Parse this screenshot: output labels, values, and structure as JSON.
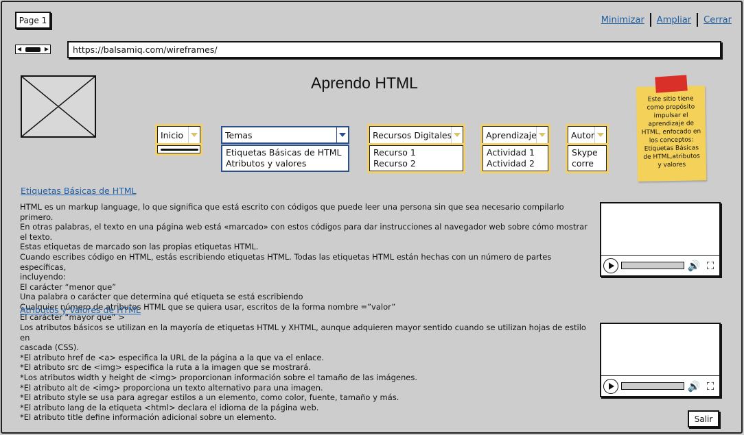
{
  "window": {
    "page_tab": "Page 1",
    "links": [
      "Minimizar",
      "Ampliar",
      "Cerrar"
    ]
  },
  "browser": {
    "url": "https://balsamiq.com/wireframes/"
  },
  "header": {
    "title": "Aprendo HTML"
  },
  "sticky_note": {
    "text": "Este sitio tiene como propósito impulsar el aprendizaje de HTML, enfocado en los conceptos: Etiquetas Básicas de HTML,atributos y valores"
  },
  "menus": {
    "inicio": {
      "label": "Inicio"
    },
    "temas": {
      "label": "Temas",
      "items": [
        "Etiquetas Básicas de HTML",
        "Atributos y valores"
      ]
    },
    "recursos": {
      "label": "Recursos Digitales",
      "items": [
        "Recurso 1",
        "Recurso 2"
      ]
    },
    "aprendizaje": {
      "label": "Aprendizaje",
      "items": [
        "Actividad 1",
        "Actividad 2"
      ]
    },
    "autor": {
      "label": "Autor",
      "items": [
        "Skype",
        "corre"
      ]
    }
  },
  "sections": [
    {
      "heading": "Etiquetas Básicas de HTML",
      "lines": [
        "HTML es un markup language, lo que significa que está escrito con códigos que puede leer una persona sin que sea necesario compilarlo primero.",
        "En otras palabras, el texto en una página web está «marcado» con estos códigos para dar instrucciones al navegador web sobre cómo mostrar el texto.",
        "Estas etiquetas de marcado son las propias etiquetas HTML.",
        "Cuando escribes código en HTML, estás escribiendo etiquetas HTML. Todas las etiquetas HTML están hechas con un número de partes específicas,",
        "incluyendo:",
        "El carácter “menor que”",
        "Una palabra o carácter que determina qué etiqueta se está escribiendo",
        "Cualquier número de atributos HTML que se quiera usar, escritos de la forma nombre =”valor”",
        "El carácter “mayor que” >"
      ]
    },
    {
      "heading": "Atributos y Valores de HTML",
      "lines": [
        "Los atributos básicos se utilizan en la mayoría de etiquetas HTML y XHTML, aunque adquieren mayor sentido cuando se utilizan hojas de estilo en",
        "cascada (CSS).",
        "*El atributo href de <a> especifica la URL de la página a la que va el enlace.",
        "*El atributo src de <img> especifica la ruta a la imagen que se mostrará.",
        "*Los atributos width y height de <img> proporcionan información sobre el tamaño de las imágenes.",
        "*El atributo alt de <img> proporciona un texto alternativo para una imagen.",
        "*El atributo style se usa para agregar estilos a un elemento, como color, fuente, tamaño y más.",
        "*El atributo lang de la etiqueta <html> declara el idioma de la página web.",
        "*El atributo title define información adicional sobre un elemento."
      ]
    }
  ],
  "footer": {
    "exit_label": "Salir"
  },
  "colors": {
    "link": "#1f5fa6",
    "sticky": "#f4d25a",
    "sticky_tape": "#d9302a",
    "menu_highlight": "#f2d06c",
    "active_menu": "#2a4f8f"
  }
}
